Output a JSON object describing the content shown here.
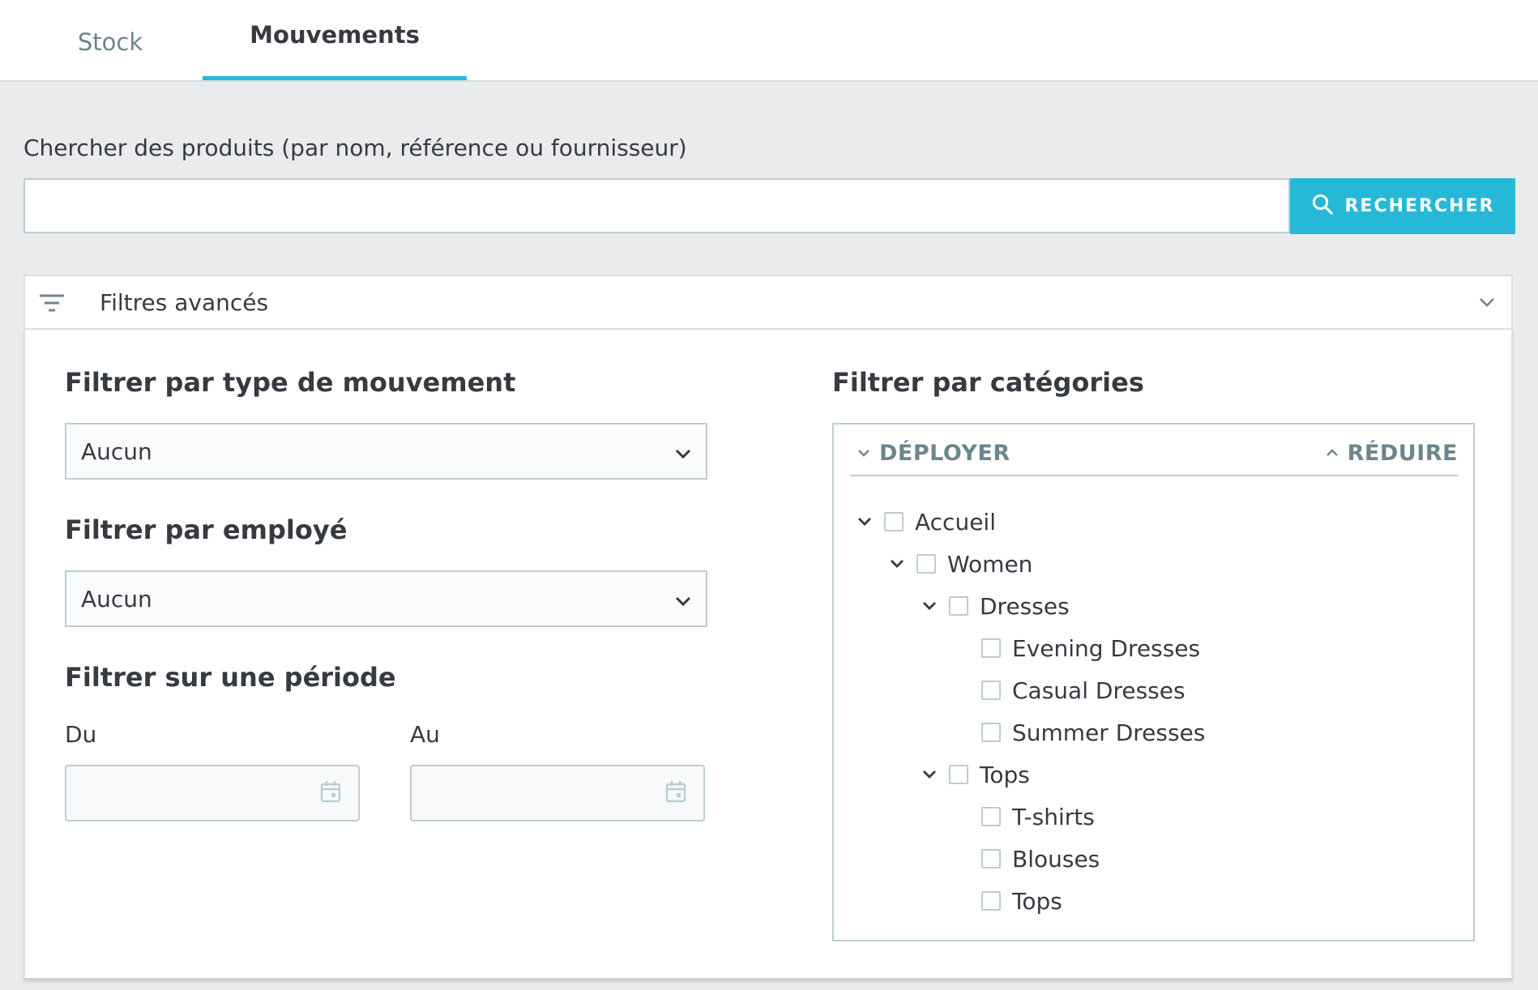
{
  "tabs": [
    {
      "label": "Stock",
      "active": false
    },
    {
      "label": "Mouvements",
      "active": true
    }
  ],
  "search": {
    "label": "Chercher des produits (par nom, référence ou fournisseur)",
    "value": "",
    "placeholder": "",
    "button_label": "RECHERCHER"
  },
  "filters": {
    "header_label": "Filtres avancés",
    "movement_type": {
      "title": "Filtrer par type de mouvement",
      "selected": "Aucun"
    },
    "employee": {
      "title": "Filtrer par employé",
      "selected": "Aucun"
    },
    "period": {
      "title": "Filtrer sur une période",
      "from_label": "Du",
      "to_label": "Au",
      "from_value": "",
      "to_value": ""
    },
    "categories": {
      "title": "Filtrer par catégories",
      "expand_label": "DÉPLOYER",
      "collapse_label": "RÉDUIRE",
      "tree": [
        {
          "label": "Accueil",
          "depth": 0,
          "expandable": true
        },
        {
          "label": "Women",
          "depth": 1,
          "expandable": true
        },
        {
          "label": "Dresses",
          "depth": 2,
          "expandable": true
        },
        {
          "label": "Evening Dresses",
          "depth": 3,
          "expandable": false
        },
        {
          "label": "Casual Dresses",
          "depth": 3,
          "expandable": false
        },
        {
          "label": "Summer Dresses",
          "depth": 3,
          "expandable": false
        },
        {
          "label": "Tops",
          "depth": 2,
          "expandable": true
        },
        {
          "label": "T-shirts",
          "depth": 3,
          "expandable": false
        },
        {
          "label": "Blouses",
          "depth": 3,
          "expandable": false
        },
        {
          "label": "Tops",
          "depth": 3,
          "expandable": false
        }
      ]
    }
  },
  "colors": {
    "accent": "#25b9d7",
    "text": "#363a41",
    "muted": "#6c868e",
    "border": "#bbcdd2"
  }
}
